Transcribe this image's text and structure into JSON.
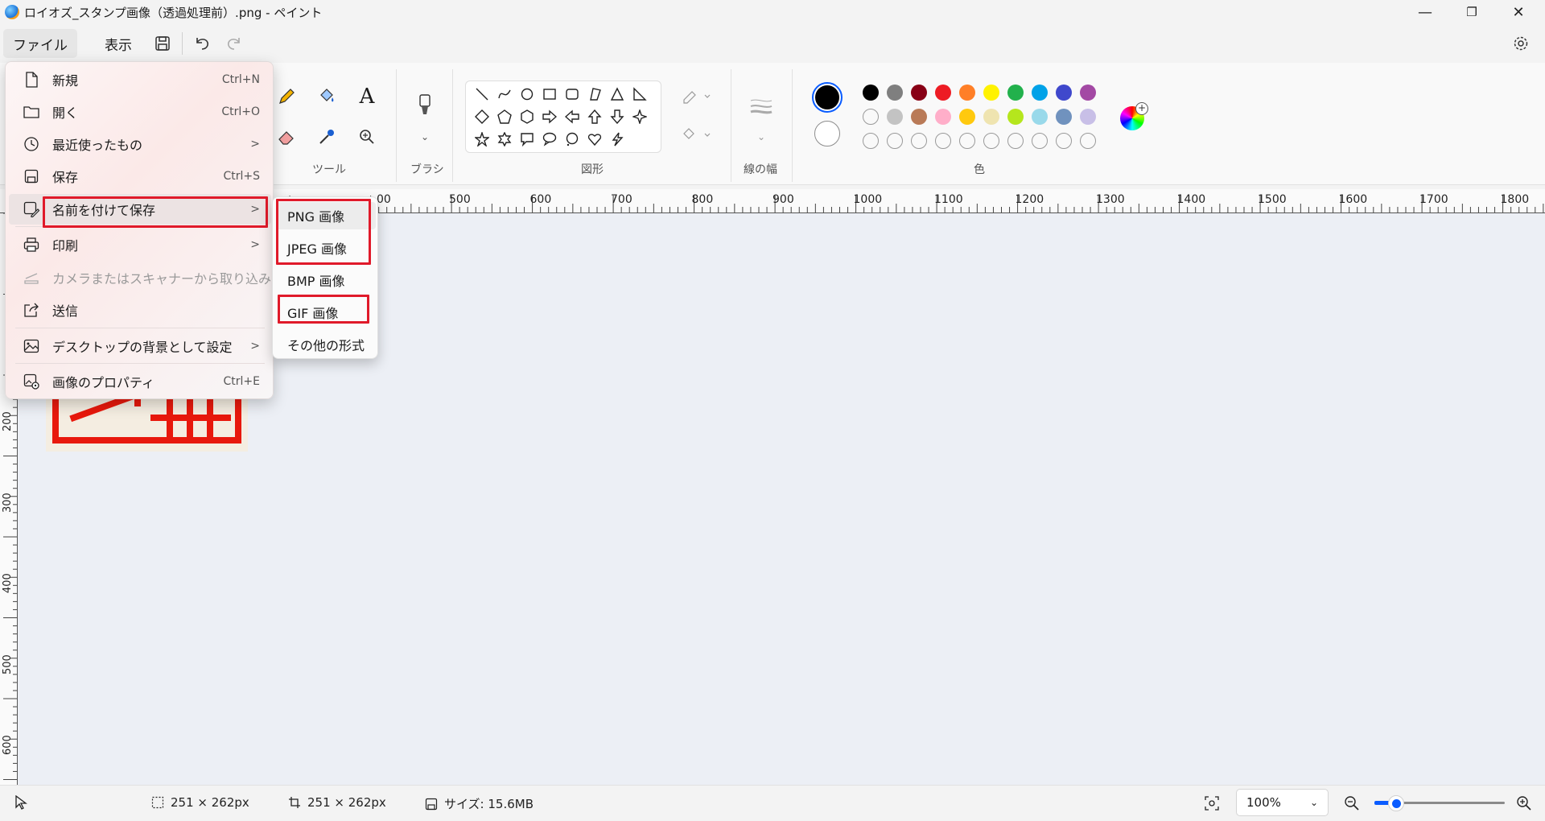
{
  "window": {
    "title": "ロイオズ_スタンプ画像（透過処理前）.png - ペイント",
    "controls": {
      "minimize": "—",
      "restore": "❐",
      "close": "✕"
    }
  },
  "menubar": {
    "file": "ファイル",
    "view": "表示"
  },
  "ribbon": {
    "tools_label": "ツール",
    "brush_label": "ブラシ",
    "shapes_label": "図形",
    "linewidth_label": "線の幅",
    "colors_label": "色",
    "text_tool": "A",
    "palette_row1": [
      "#000000",
      "#7f7f7f",
      "#880015",
      "#ed1c24",
      "#ff7f27",
      "#fff200",
      "#22b14c",
      "#00a2e8",
      "#3f48cc",
      "#a349a4"
    ],
    "palette_row2": [
      "empty",
      "#c3c3c3",
      "#b97a57",
      "#ffaec9",
      "#ffc90e",
      "#efe4b0",
      "#b5e61d",
      "#99d9ea",
      "#7092be",
      "#c8bfe7"
    ],
    "palette_row3": [
      "empty",
      "empty",
      "empty",
      "empty",
      "empty",
      "empty",
      "empty",
      "empty",
      "empty",
      "empty"
    ]
  },
  "ruler": {
    "h_labels": [
      "00",
      "500",
      "600",
      "700",
      "800",
      "900",
      "1000",
      "1100",
      "1200",
      "1300",
      "1400",
      "1500",
      "1600",
      "1700",
      "1800"
    ],
    "v_labels": [
      "200",
      "300",
      "400",
      "500",
      "600"
    ]
  },
  "file_menu": {
    "items": [
      {
        "label": "新規",
        "shortcut": "Ctrl+N",
        "icon": "new-file-icon"
      },
      {
        "label": "開く",
        "shortcut": "Ctrl+O",
        "icon": "folder-open-icon"
      },
      {
        "label": "最近使ったもの",
        "arrow": ">",
        "icon": "clock-icon"
      },
      {
        "label": "保存",
        "shortcut": "Ctrl+S",
        "icon": "save-icon"
      },
      {
        "label": "名前を付けて保存",
        "arrow": ">",
        "icon": "save-as-icon"
      },
      {
        "label": "印刷",
        "arrow": ">",
        "icon": "printer-icon"
      },
      {
        "label": "カメラまたはスキャナーから取り込み",
        "icon": "scanner-icon"
      },
      {
        "label": "送信",
        "icon": "share-icon"
      },
      {
        "label": "デスクトップの背景として設定",
        "arrow": ">",
        "icon": "desktop-background-icon"
      },
      {
        "label": "画像のプロパティ",
        "shortcut": "Ctrl+E",
        "icon": "image-properties-icon"
      }
    ]
  },
  "save_as_submenu": {
    "items": [
      "PNG 画像",
      "JPEG 画像",
      "BMP 画像",
      "GIF 画像",
      "その他の形式"
    ]
  },
  "statusbar": {
    "selection_size": "251 × 262px",
    "canvas_size": "251 × 262px",
    "file_size": "サイズ: 15.6MB",
    "zoom": "100%",
    "zoom_fraction": 0.12
  },
  "colors": {
    "accent": "#0a5cff",
    "highlight": "#e01a2a",
    "stamp_red": "#e8180c"
  }
}
